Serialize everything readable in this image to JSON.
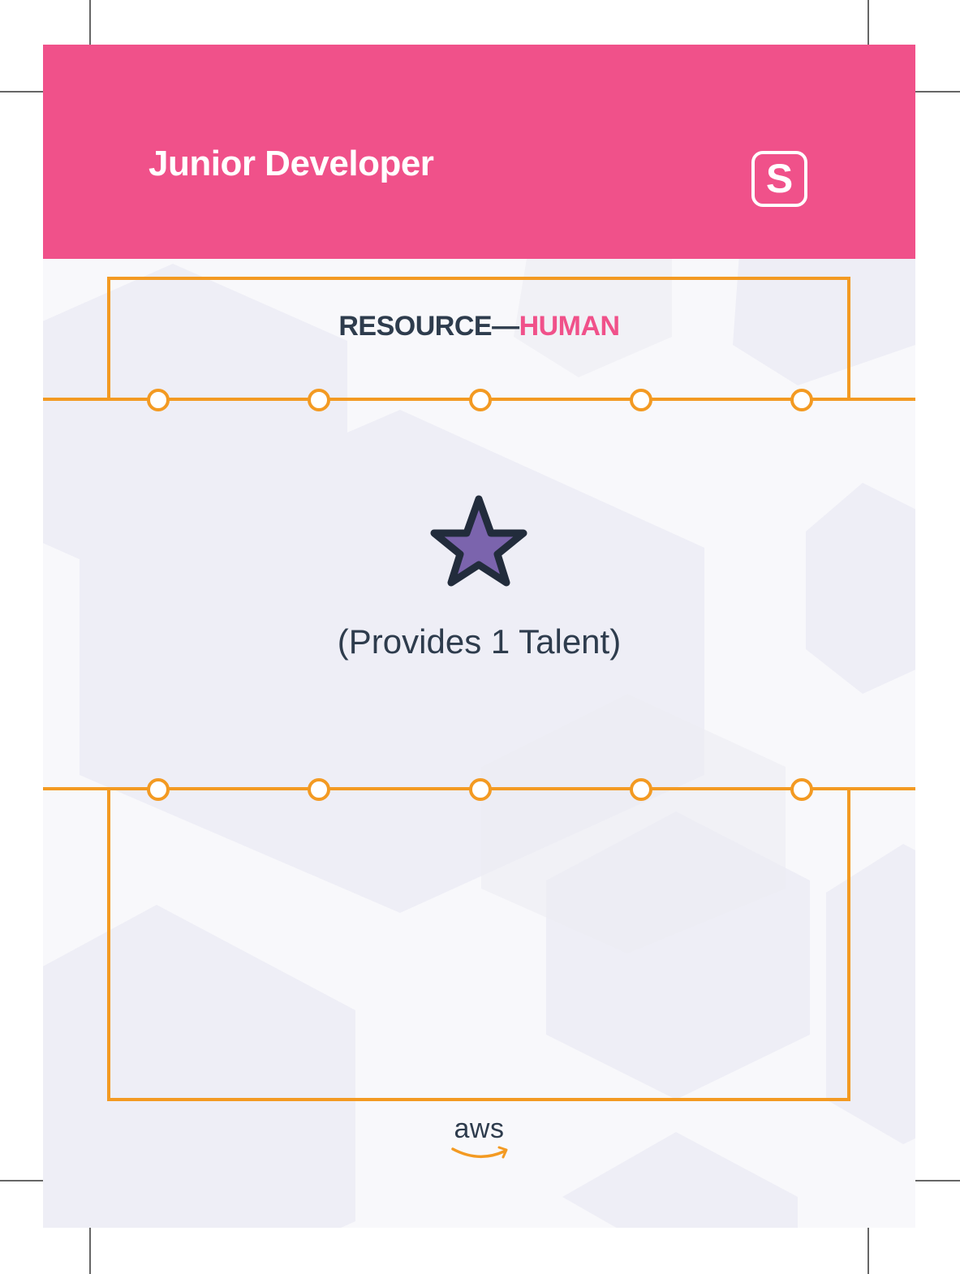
{
  "card": {
    "title": "Junior Developer",
    "badge_letter": "S",
    "type_primary": "RESOURCE—",
    "type_secondary": "HUMAN",
    "effect": "(Provides 1 Talent)",
    "brand": "aws"
  },
  "icons": {
    "main": "star-icon",
    "logo": "aws-logo"
  },
  "colors": {
    "header": "#f0518a",
    "accent_line": "#f39a22",
    "star_fill": "#7b64ad",
    "star_stroke": "#222c3c",
    "text": "#2e3c4d"
  }
}
